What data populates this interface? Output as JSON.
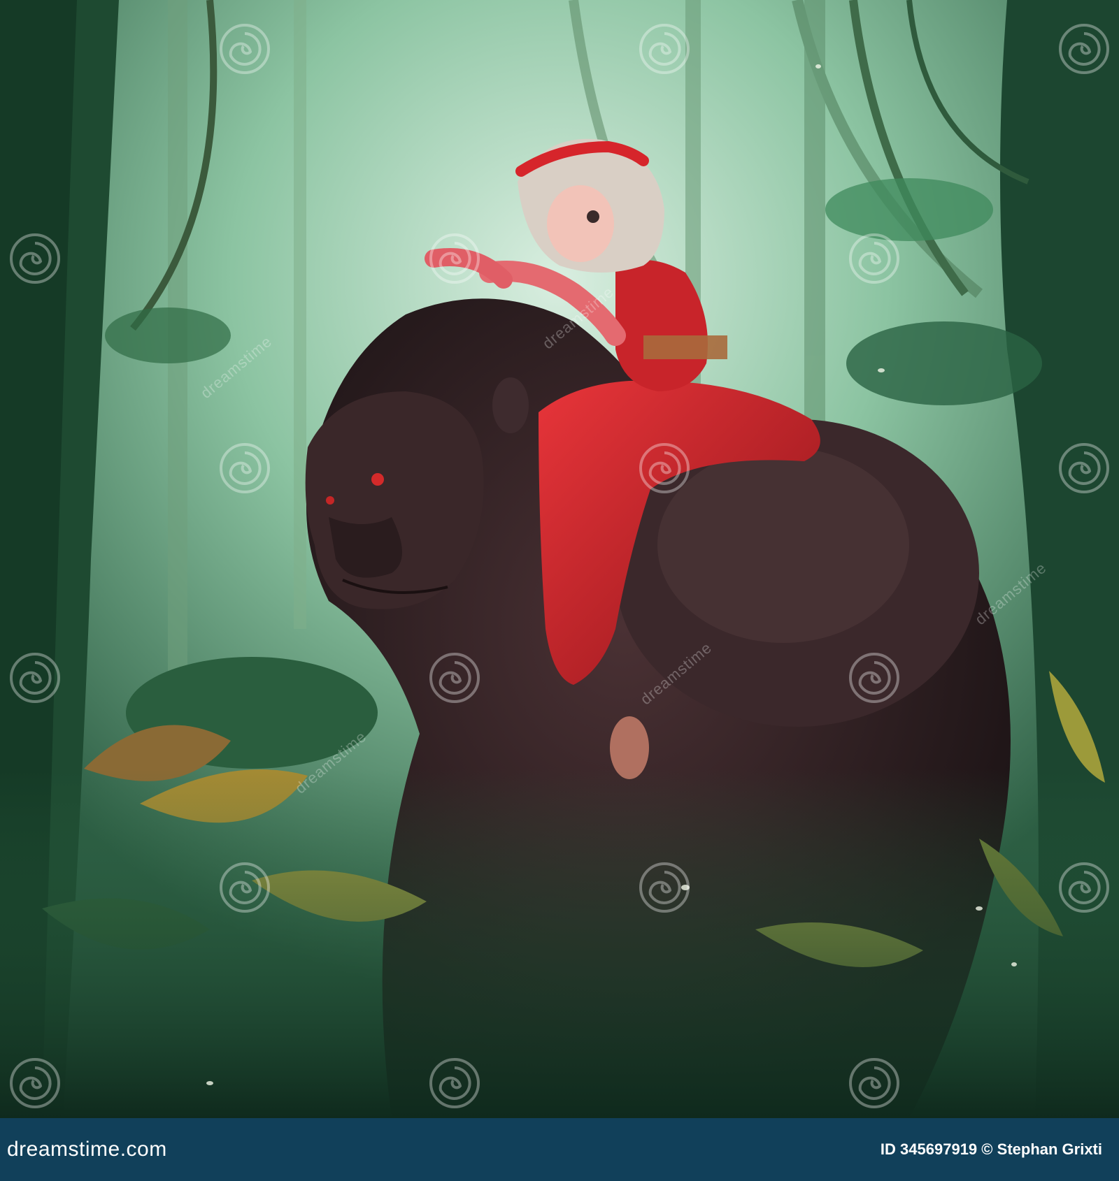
{
  "photo": {
    "subject": "anime girl in red dress riding a gorilla in the jungle"
  },
  "watermark": {
    "repeated_text": "dreamstime",
    "icon": "dreamstime-spiral-icon"
  },
  "footer": {
    "site": "dreamstime.com",
    "id_label": "ID",
    "id_value": "345697919",
    "copyright_symbol": "©",
    "author": "Stephan Grixti"
  },
  "colors": {
    "footer_bg": "#11405a",
    "dress_red": "#c8242a",
    "fur_dark": "#2b1f22",
    "jungle_green": "#2f6b45"
  }
}
